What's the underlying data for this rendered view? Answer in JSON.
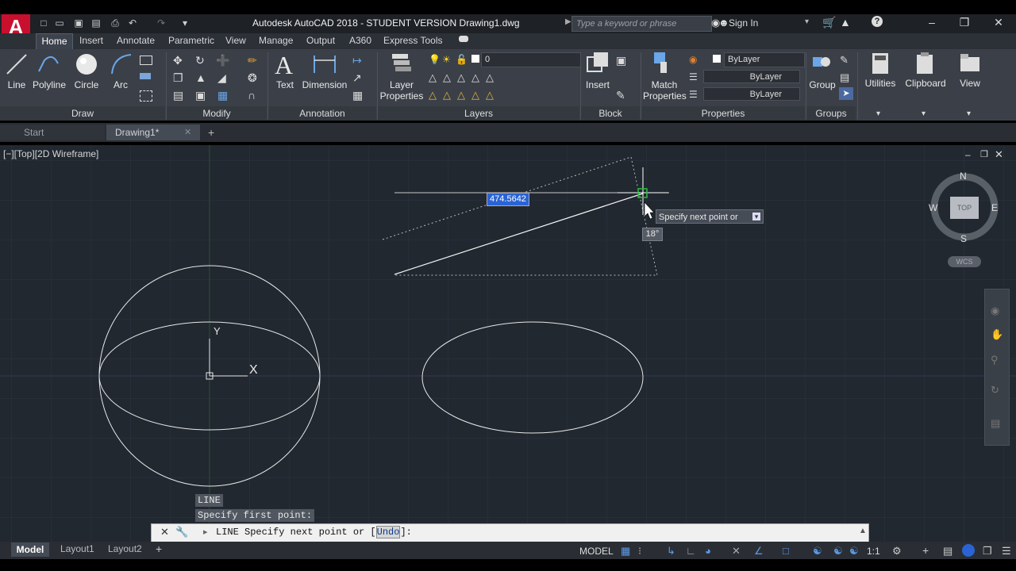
{
  "app": {
    "logo": "A",
    "title": "Autodesk AutoCAD 2018 - STUDENT VERSION    Drawing1.dwg",
    "search_placeholder": "Type a keyword or phrase",
    "sign_in": "Sign In"
  },
  "ribbon_tabs": [
    "Home",
    "Insert",
    "Annotate",
    "Parametric",
    "View",
    "Manage",
    "Output",
    "A360",
    "Express Tools"
  ],
  "draw_panel": {
    "line": "Line",
    "polyline": "Polyline",
    "circle": "Circle",
    "arc": "Arc",
    "label": "Draw"
  },
  "modify_panel": {
    "label": "Modify"
  },
  "annotation_panel": {
    "text": "Text",
    "dimension": "Dimension",
    "label": "Annotation"
  },
  "layers_panel": {
    "layer_properties_line1": "Layer",
    "layer_properties_line2": "Properties",
    "current_layer": "0",
    "label": "Layers"
  },
  "block_panel": {
    "insert": "Insert",
    "label": "Block"
  },
  "properties_panel": {
    "match_line1": "Match",
    "match_line2": "Properties",
    "color": "ByLayer",
    "linetype": "ByLayer",
    "lineweight": "ByLayer",
    "label": "Properties"
  },
  "groups_panel": {
    "group": "Group",
    "label": "Groups"
  },
  "extra_panels": {
    "utilities": "Utilities",
    "clipboard": "Clipboard",
    "view": "View"
  },
  "file_tabs": {
    "start": "Start",
    "drawing": "Drawing1*"
  },
  "viewport": {
    "label": "[−][Top][2D Wireframe]",
    "length_input": "474.5642",
    "tooltip": "Specify next point or",
    "angle": "18°",
    "ucs_y": "Y",
    "ucs_x": "X"
  },
  "viewcube": {
    "north": "N",
    "south": "S",
    "east": "E",
    "west": "W",
    "face": "TOP",
    "wcs": "WCS"
  },
  "command": {
    "history1": "LINE",
    "history2": "Specify first point:",
    "prompt_prefix": "LINE Specify next point or [",
    "prompt_option": "Undo",
    "prompt_suffix": "]:"
  },
  "layout_tabs": [
    "Model",
    "Layout1",
    "Layout2"
  ],
  "status": {
    "model": "MODEL",
    "scale": "1:1"
  },
  "colors": {
    "canvas": "#212830",
    "ribbon": "#3b4048",
    "accent_red": "#c8102e",
    "selection_blue": "#2a63d4"
  }
}
